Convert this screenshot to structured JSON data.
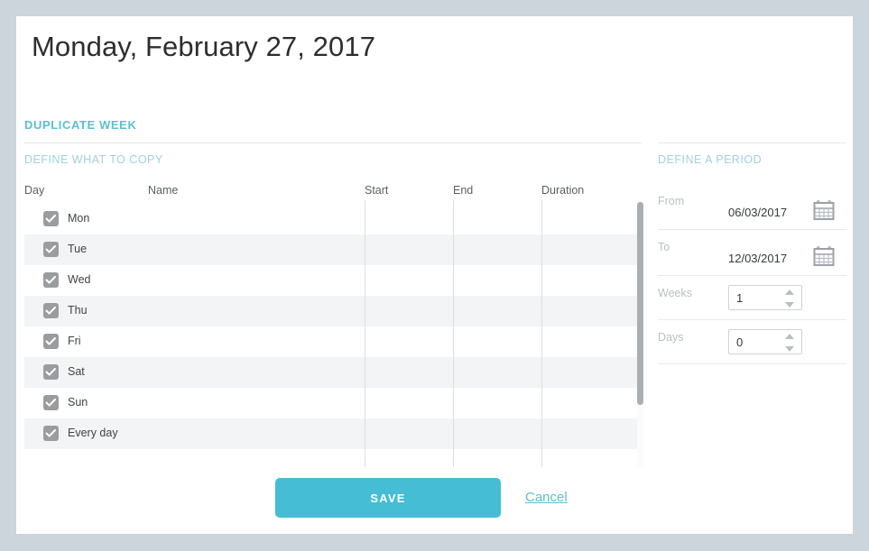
{
  "page": {
    "title": "Monday, February 27, 2017",
    "section_title": "DUPLICATE WEEK"
  },
  "copy_panel": {
    "subsection_title": "DEFINE WHAT TO COPY",
    "columns": {
      "day": "Day",
      "name": "Name",
      "start": "Start",
      "end": "End",
      "duration": "Duration"
    },
    "rows": [
      {
        "day": "Mon",
        "checked": true,
        "name": "",
        "start": "",
        "end": "",
        "duration": ""
      },
      {
        "day": "Tue",
        "checked": true,
        "name": "",
        "start": "",
        "end": "",
        "duration": ""
      },
      {
        "day": "Wed",
        "checked": true,
        "name": "",
        "start": "",
        "end": "",
        "duration": ""
      },
      {
        "day": "Thu",
        "checked": true,
        "name": "",
        "start": "",
        "end": "",
        "duration": ""
      },
      {
        "day": "Fri",
        "checked": true,
        "name": "",
        "start": "",
        "end": "",
        "duration": ""
      },
      {
        "day": "Sat",
        "checked": true,
        "name": "",
        "start": "",
        "end": "",
        "duration": ""
      },
      {
        "day": "Sun",
        "checked": true,
        "name": "",
        "start": "",
        "end": "",
        "duration": ""
      },
      {
        "day": "Every day",
        "checked": true,
        "name": "",
        "start": "",
        "end": "",
        "duration": ""
      }
    ]
  },
  "period_panel": {
    "subsection_title": "DEFINE A PERIOD",
    "from": {
      "label": "From",
      "value": "06/03/2017",
      "icon": "calendar-icon"
    },
    "to": {
      "label": "To",
      "value": "12/03/2017",
      "icon": "calendar-icon"
    },
    "weeks": {
      "label": "Weeks",
      "value": "1"
    },
    "days": {
      "label": "Days",
      "value": "0"
    }
  },
  "footer": {
    "save_label": "SAVE",
    "cancel_label": "Cancel"
  },
  "colors": {
    "accent": "#45bdd4",
    "accent_light": "#9fd2de",
    "page_background": "#ccd4dc",
    "row_stripe": "#f2f4f6",
    "checkbox": "#9a9da0"
  }
}
